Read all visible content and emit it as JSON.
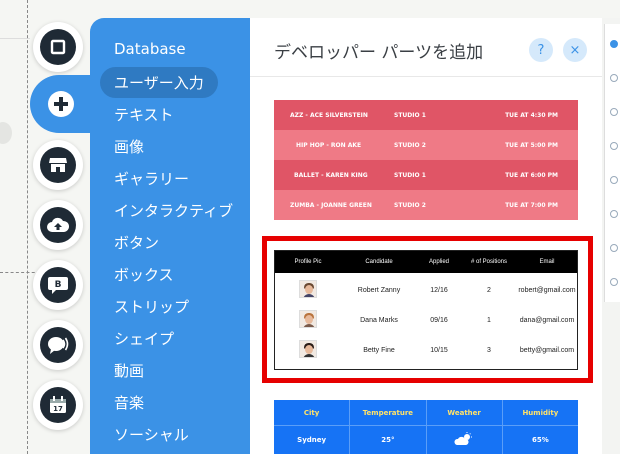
{
  "sidebar_icons": [
    {
      "name": "container-square-icon"
    },
    {
      "name": "add-plus-icon",
      "active": true
    },
    {
      "name": "store-icon"
    },
    {
      "name": "cloud-upload-icon"
    },
    {
      "name": "blog-icon",
      "label": "B"
    },
    {
      "name": "chat-speaker-icon"
    },
    {
      "name": "calendar-icon",
      "label": "17"
    }
  ],
  "categories": [
    {
      "label": "Database"
    },
    {
      "label": "ユーザー入力",
      "selected": true
    },
    {
      "label": "テキスト"
    },
    {
      "label": "画像"
    },
    {
      "label": "ギャラリー"
    },
    {
      "label": "インタラクティブ"
    },
    {
      "label": "ボタン"
    },
    {
      "label": "ボックス"
    },
    {
      "label": "ストリップ"
    },
    {
      "label": "シェイプ"
    },
    {
      "label": "動画"
    },
    {
      "label": "音楽"
    },
    {
      "label": "ソーシャル"
    }
  ],
  "panel": {
    "title": "デベロッパー パーツを追加",
    "help_label": "?",
    "close_label": "×"
  },
  "schedule": [
    {
      "name": "AZZ - ACE SILVERSTEIN",
      "studio": "STUDIO 1",
      "time": "TUE AT 4:30 PM"
    },
    {
      "name": "HIP HOP - RON AKE",
      "studio": "STUDIO 2",
      "time": "TUE AT 5:00 PM"
    },
    {
      "name": "BALLET - KAREN KING",
      "studio": "STUDIO 1",
      "time": "TUE AT 6:00 PM"
    },
    {
      "name": "ZUMBA - JOANNE GREEN",
      "studio": "STUDIO 2",
      "time": "TUE AT 7:00 PM"
    }
  ],
  "candidates": {
    "headers": [
      "Profile Pic",
      "Candidate",
      "Applied",
      "# of Positions",
      "Email"
    ],
    "rows": [
      {
        "name": "Robert Zanny",
        "applied": "12/16",
        "positions": "2",
        "email": "robert@gmail.com"
      },
      {
        "name": "Dana Marks",
        "applied": "09/16",
        "positions": "1",
        "email": "dana@gmail.com"
      },
      {
        "name": "Betty Fine",
        "applied": "10/15",
        "positions": "3",
        "email": "betty@gmail.com"
      }
    ]
  },
  "weather": {
    "headers": [
      "City",
      "Temperature",
      "Weather",
      "Humidity"
    ],
    "row": {
      "city": "Sydney",
      "temperature": "25°",
      "weather_icon": "partly-sunny-icon",
      "humidity": "65%"
    }
  },
  "colors": {
    "accent": "#3b92e6",
    "highlight": "#e60000",
    "schedule_dark": "#e05566",
    "schedule_light": "#ef7a86",
    "weather_bg": "#1673f5"
  }
}
